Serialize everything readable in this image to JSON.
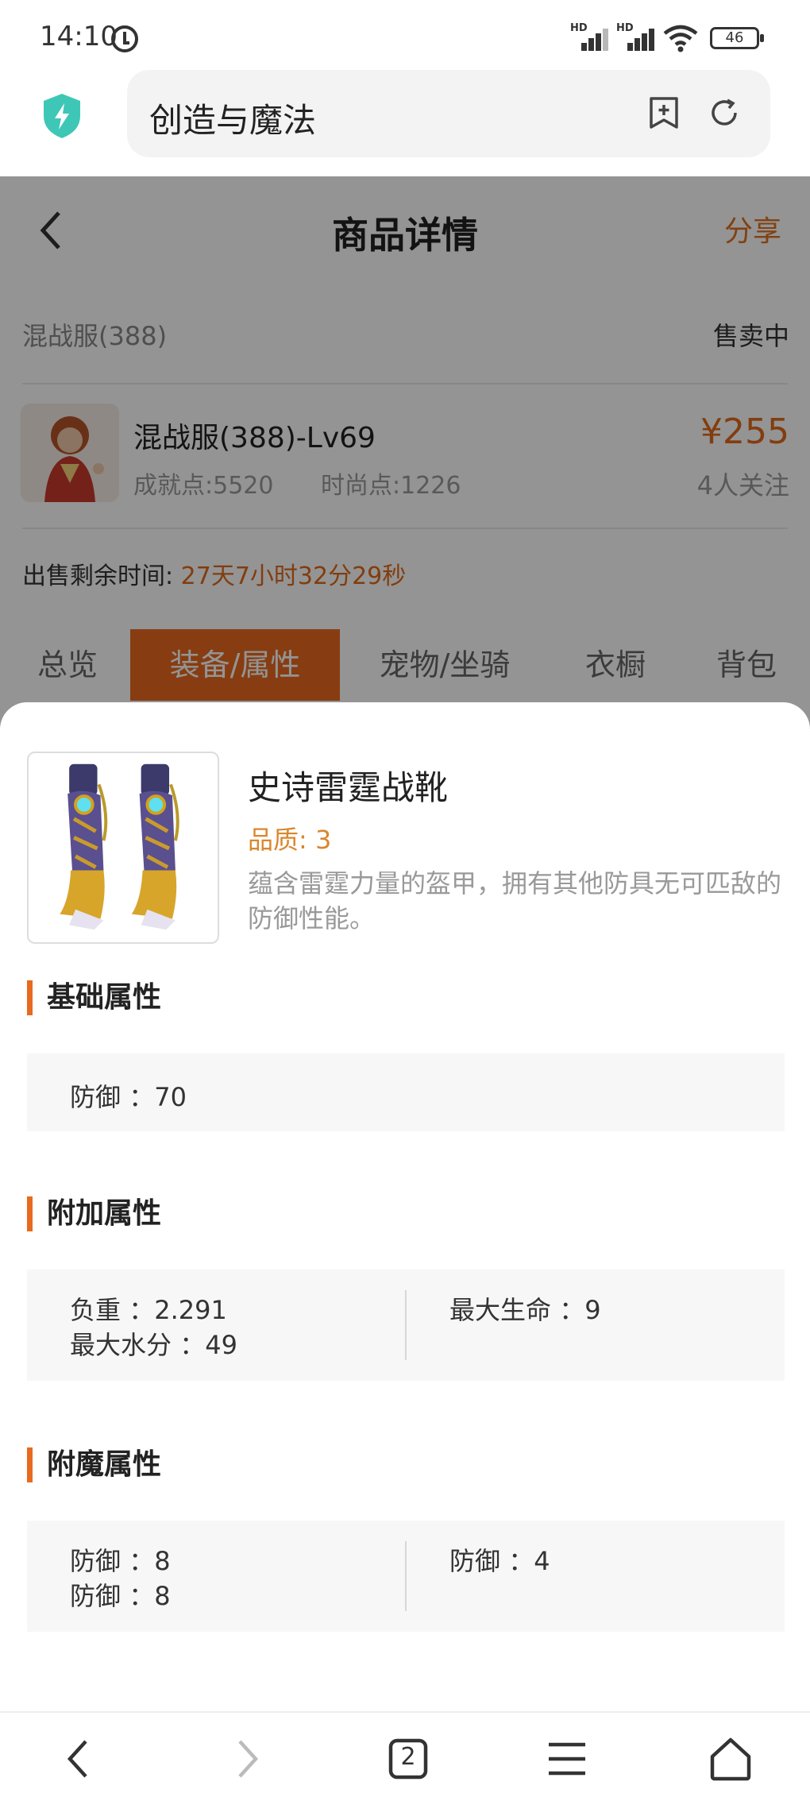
{
  "status_bar": {
    "time": "14:10",
    "hd1": "HD",
    "hd2": "HD",
    "battery": "46"
  },
  "browser": {
    "url_text": "创造与魔法",
    "tab_count": "2"
  },
  "header": {
    "title": "商品详情",
    "share": "分享"
  },
  "listing": {
    "server": "混战服(388)",
    "status": "售卖中",
    "role_name": "混战服(388)-Lv69",
    "achievement": "成就点:5520",
    "fashion": "时尚点:1226",
    "price": "¥255",
    "followers": "4人关注",
    "remain_label": "出售剩余时间: ",
    "remain_time": "27天7小时32分29秒"
  },
  "tabs": [
    "总览",
    "装备/属性",
    "宠物/坐骑",
    "衣橱",
    "背包"
  ],
  "item": {
    "name": "史诗雷霆战靴",
    "quality": "品质: 3",
    "description": "蕴含雷霆力量的盔甲，拥有其他防具无可匹敌的防御性能。"
  },
  "sections": {
    "base": {
      "title": "基础属性",
      "attrs": [
        {
          "label": "防御",
          "value": "70"
        }
      ]
    },
    "extra": {
      "title": "附加属性",
      "left": [
        {
          "label": "负重",
          "value": "2.291"
        },
        {
          "label": "最大水分",
          "value": "49"
        }
      ],
      "right": [
        {
          "label": "最大生命",
          "value": "9"
        }
      ]
    },
    "enchant": {
      "title": "附魔属性",
      "left": [
        {
          "label": "防御",
          "value": "8"
        },
        {
          "label": "防御",
          "value": "8"
        }
      ],
      "right": [
        {
          "label": "防御",
          "value": "4"
        }
      ]
    }
  },
  "colors": {
    "accent": "#e86a1e",
    "price": "#e06a1a",
    "quality": "#d9872d"
  },
  "icons": [
    "alarm-icon",
    "signal-icon",
    "wifi-icon",
    "battery-icon",
    "shield-icon",
    "bookmark-icon",
    "refresh-icon",
    "back-icon",
    "forward-icon",
    "tabs-icon",
    "menu-icon",
    "home-icon"
  ]
}
